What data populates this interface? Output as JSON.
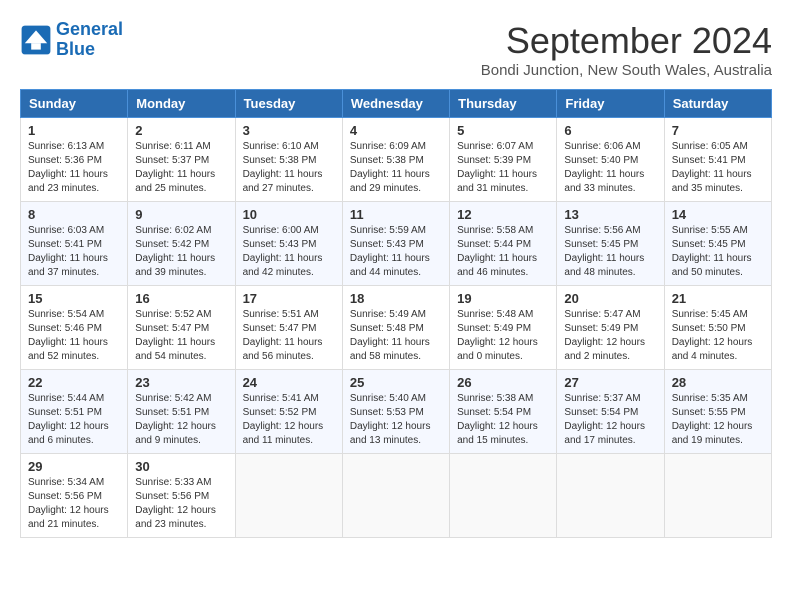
{
  "header": {
    "logo_line1": "General",
    "logo_line2": "Blue",
    "month": "September 2024",
    "location": "Bondi Junction, New South Wales, Australia"
  },
  "days_of_week": [
    "Sunday",
    "Monday",
    "Tuesday",
    "Wednesday",
    "Thursday",
    "Friday",
    "Saturday"
  ],
  "weeks": [
    [
      {
        "day": "1",
        "sunrise": "6:13 AM",
        "sunset": "5:36 PM",
        "daylight": "11 hours and 23 minutes."
      },
      {
        "day": "2",
        "sunrise": "6:11 AM",
        "sunset": "5:37 PM",
        "daylight": "11 hours and 25 minutes."
      },
      {
        "day": "3",
        "sunrise": "6:10 AM",
        "sunset": "5:38 PM",
        "daylight": "11 hours and 27 minutes."
      },
      {
        "day": "4",
        "sunrise": "6:09 AM",
        "sunset": "5:38 PM",
        "daylight": "11 hours and 29 minutes."
      },
      {
        "day": "5",
        "sunrise": "6:07 AM",
        "sunset": "5:39 PM",
        "daylight": "11 hours and 31 minutes."
      },
      {
        "day": "6",
        "sunrise": "6:06 AM",
        "sunset": "5:40 PM",
        "daylight": "11 hours and 33 minutes."
      },
      {
        "day": "7",
        "sunrise": "6:05 AM",
        "sunset": "5:41 PM",
        "daylight": "11 hours and 35 minutes."
      }
    ],
    [
      {
        "day": "8",
        "sunrise": "6:03 AM",
        "sunset": "5:41 PM",
        "daylight": "11 hours and 37 minutes."
      },
      {
        "day": "9",
        "sunrise": "6:02 AM",
        "sunset": "5:42 PM",
        "daylight": "11 hours and 39 minutes."
      },
      {
        "day": "10",
        "sunrise": "6:00 AM",
        "sunset": "5:43 PM",
        "daylight": "11 hours and 42 minutes."
      },
      {
        "day": "11",
        "sunrise": "5:59 AM",
        "sunset": "5:43 PM",
        "daylight": "11 hours and 44 minutes."
      },
      {
        "day": "12",
        "sunrise": "5:58 AM",
        "sunset": "5:44 PM",
        "daylight": "11 hours and 46 minutes."
      },
      {
        "day": "13",
        "sunrise": "5:56 AM",
        "sunset": "5:45 PM",
        "daylight": "11 hours and 48 minutes."
      },
      {
        "day": "14",
        "sunrise": "5:55 AM",
        "sunset": "5:45 PM",
        "daylight": "11 hours and 50 minutes."
      }
    ],
    [
      {
        "day": "15",
        "sunrise": "5:54 AM",
        "sunset": "5:46 PM",
        "daylight": "11 hours and 52 minutes."
      },
      {
        "day": "16",
        "sunrise": "5:52 AM",
        "sunset": "5:47 PM",
        "daylight": "11 hours and 54 minutes."
      },
      {
        "day": "17",
        "sunrise": "5:51 AM",
        "sunset": "5:47 PM",
        "daylight": "11 hours and 56 minutes."
      },
      {
        "day": "18",
        "sunrise": "5:49 AM",
        "sunset": "5:48 PM",
        "daylight": "11 hours and 58 minutes."
      },
      {
        "day": "19",
        "sunrise": "5:48 AM",
        "sunset": "5:49 PM",
        "daylight": "12 hours and 0 minutes."
      },
      {
        "day": "20",
        "sunrise": "5:47 AM",
        "sunset": "5:49 PM",
        "daylight": "12 hours and 2 minutes."
      },
      {
        "day": "21",
        "sunrise": "5:45 AM",
        "sunset": "5:50 PM",
        "daylight": "12 hours and 4 minutes."
      }
    ],
    [
      {
        "day": "22",
        "sunrise": "5:44 AM",
        "sunset": "5:51 PM",
        "daylight": "12 hours and 6 minutes."
      },
      {
        "day": "23",
        "sunrise": "5:42 AM",
        "sunset": "5:51 PM",
        "daylight": "12 hours and 9 minutes."
      },
      {
        "day": "24",
        "sunrise": "5:41 AM",
        "sunset": "5:52 PM",
        "daylight": "12 hours and 11 minutes."
      },
      {
        "day": "25",
        "sunrise": "5:40 AM",
        "sunset": "5:53 PM",
        "daylight": "12 hours and 13 minutes."
      },
      {
        "day": "26",
        "sunrise": "5:38 AM",
        "sunset": "5:54 PM",
        "daylight": "12 hours and 15 minutes."
      },
      {
        "day": "27",
        "sunrise": "5:37 AM",
        "sunset": "5:54 PM",
        "daylight": "12 hours and 17 minutes."
      },
      {
        "day": "28",
        "sunrise": "5:35 AM",
        "sunset": "5:55 PM",
        "daylight": "12 hours and 19 minutes."
      }
    ],
    [
      {
        "day": "29",
        "sunrise": "5:34 AM",
        "sunset": "5:56 PM",
        "daylight": "12 hours and 21 minutes."
      },
      {
        "day": "30",
        "sunrise": "5:33 AM",
        "sunset": "5:56 PM",
        "daylight": "12 hours and 23 minutes."
      },
      null,
      null,
      null,
      null,
      null
    ]
  ]
}
